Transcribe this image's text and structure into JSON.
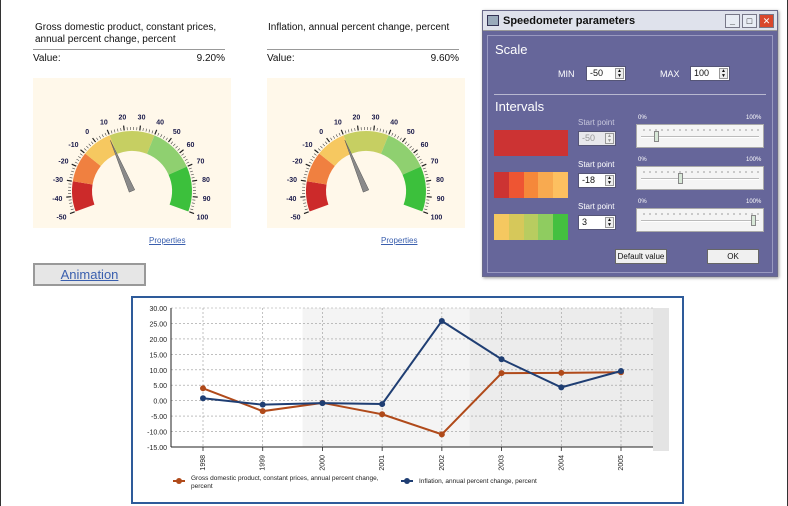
{
  "gauges": [
    {
      "title": "Gross domestic product, constant prices, annual percent change, percent",
      "value_label": "Value:",
      "value": "9.20%",
      "needle_value": 9.2,
      "properties_label": "Properties"
    },
    {
      "title": "Inflation, annual percent change, percent",
      "value_label": "Value:",
      "value": "9.60%",
      "needle_value": 9.6,
      "properties_label": "Properties"
    }
  ],
  "gauge_scale": {
    "min": -50,
    "max": 100,
    "ticks": [
      "-50",
      "-40",
      "-30",
      "-20",
      "-10",
      "0",
      "10",
      "20",
      "30",
      "40",
      "50",
      "60",
      "70",
      "80",
      "90",
      "100"
    ]
  },
  "animation_label": "Animation",
  "dialog": {
    "title": "Speedometer parameters",
    "scale_title": "Scale",
    "min_label": "MIN",
    "min_value": "-50",
    "max_label": "MAX",
    "max_value": "100",
    "intervals_title": "Intervals",
    "start_point_label": "Start point",
    "pct_left": "0%",
    "pct_right": "100%",
    "intervals": [
      {
        "start": "-50",
        "disabled": true,
        "colors": [
          "#cc3333",
          "#cc3333",
          "#cc3333",
          "#cc3333",
          "#cc3333"
        ],
        "thumb": 0.12
      },
      {
        "start": "-18",
        "disabled": false,
        "colors": [
          "#cc3333",
          "#ee5533",
          "#f5883a",
          "#f8aa50",
          "#fdc060"
        ],
        "thumb": 0.33
      },
      {
        "start": "3",
        "disabled": false,
        "colors": [
          "#f5c860",
          "#d6c85a",
          "#b8cc60",
          "#8fcc60",
          "#44c040"
        ],
        "thumb": 0.98
      }
    ],
    "default_label": "Default value",
    "ok_label": "OK"
  },
  "colors": {
    "gdp": "#b04a1a",
    "inflation": "#1f3e73",
    "dialog_bg": "#66669a"
  },
  "chart_data": {
    "type": "line",
    "categories": [
      "1998",
      "1999",
      "2000",
      "2001",
      "2002",
      "2003",
      "2004",
      "2005"
    ],
    "ylim": [
      -15,
      30
    ],
    "y_ticks": [
      "30.00",
      "25.00",
      "20.00",
      "15.00",
      "10.00",
      "5.00",
      "0.00",
      "-5.00",
      "-10.00",
      "-15.00"
    ],
    "series": [
      {
        "name": "Gross domestic product, constant prices, annual percent change, percent",
        "color": "#b04a1a",
        "values": [
          4.0,
          -3.4,
          -0.7,
          -4.4,
          -10.9,
          8.9,
          9.0,
          9.2
        ]
      },
      {
        "name": "Inflation, annual percent change, percent",
        "color": "#1f3e73",
        "values": [
          0.8,
          -1.3,
          -0.8,
          -1.1,
          25.8,
          13.4,
          4.3,
          9.6
        ]
      }
    ]
  }
}
